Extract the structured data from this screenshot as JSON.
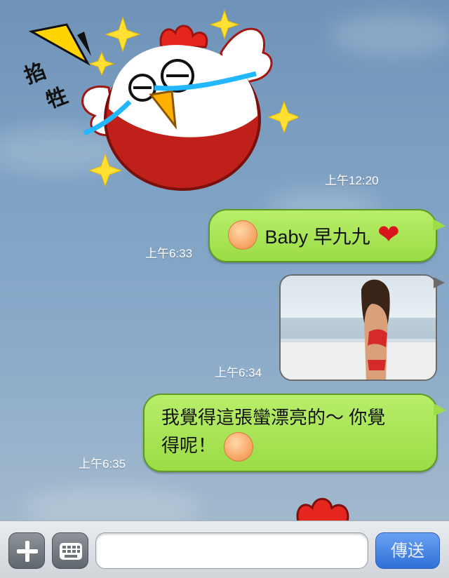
{
  "sticker_top": {
    "text_1": "掐",
    "text_2": "牲"
  },
  "messages": [
    {
      "type": "sticker",
      "time": "上午12:20"
    },
    {
      "type": "text",
      "time": "上午6:33",
      "text": "Baby 早九九"
    },
    {
      "type": "image",
      "time": "上午6:34"
    },
    {
      "type": "text",
      "time": "上午6:35",
      "line1": "我覺得這張蠻漂亮的～ 你覺",
      "line2": "得呢！"
    }
  ],
  "toolbar": {
    "add_icon": "plus-icon",
    "keyboard_icon": "keyboard-icon",
    "input_value": "",
    "send_label": "傳送"
  },
  "colors": {
    "bubble_green": "#9bdc45",
    "send_blue": "#2f6fd8"
  }
}
